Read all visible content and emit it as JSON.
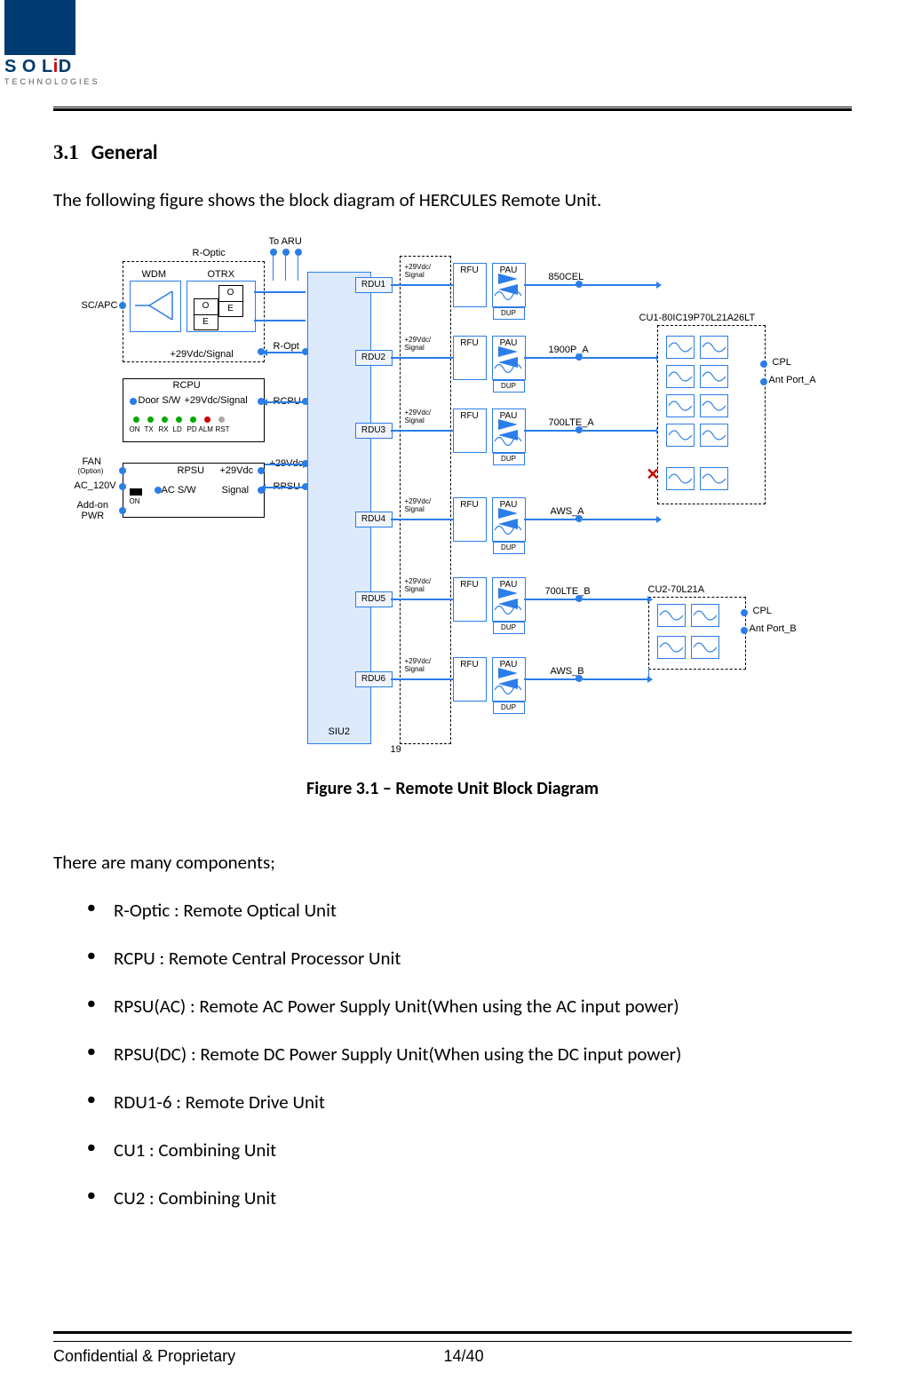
{
  "logo": {
    "brand_main": "S O L",
    "brand_i": "i",
    "brand_d": "D",
    "brand_sub": "TECHNOLOGIES"
  },
  "section": {
    "number": "3.1",
    "title": "General"
  },
  "intro": "The following figure shows the block diagram of HERCULES Remote Unit.",
  "figure_caption": "Figure 3.1 – Remote Unit Block Diagram",
  "components_intro": "There are many components;",
  "components": [
    "R-Optic : Remote Optical Unit",
    "RCPU : Remote Central Processor Unit",
    "RPSU(AC) :    Remote AC Power Supply Unit(When using the AC input power)",
    "RPSU(DC) :    Remote DC Power Supply Unit(When using the DC input power)",
    "RDU1-6 : Remote Drive Unit",
    "CU1 : Combining Unit",
    "CU2 : Combining Unit"
  ],
  "footer": {
    "left": "Confidential & Proprietary",
    "page": "14/40"
  },
  "diagram": {
    "labels": {
      "to_aru": "To ARU",
      "r_optic": "R-Optic",
      "wdm": "WDM",
      "otrx": "OTRX",
      "sc_apc": "SC/APC",
      "o": "O",
      "e": "E",
      "p29_sig": "+29Vdc/Signal",
      "r_opt": "R-Opt",
      "rcpu": "RCPU",
      "door_sw": "Door S/W",
      "p29_sig2": "+29Vdc/Signal",
      "on": "ON",
      "tx": "TX",
      "rx": "RX",
      "ld": "LD",
      "pd": "PD",
      "alm": "ALM",
      "rst": "RST",
      "fan": "FAN",
      "option": "(Option)",
      "ac120": "AC_120V",
      "addon": "Add-on",
      "pwr": "PWR",
      "rpsu": "RPSU",
      "p29": "+29Vdc",
      "acsw": "AC S/W",
      "signal": "Signal",
      "siu2": "SIU2",
      "rdu1": "RDU1",
      "rdu2": "RDU2",
      "rdu3": "RDU3",
      "rdu4": "RDU4",
      "rdu5": "RDU5",
      "rdu6": "RDU6",
      "p29vdc_sig_tiny": "+29Vdc/\nSignal",
      "rfu": "RFU",
      "pau": "PAU",
      "dup": "DUP",
      "band1": "850CEL",
      "band2": "1900P_A",
      "band3": "700LTE_A",
      "band4": "AWS_A",
      "band5": "700LTE_B",
      "band6": "AWS_B",
      "cu1": "CU1-80IC19P70L21A26LT",
      "cu2": "CU2-70L21A",
      "cpl": "CPL",
      "ant_a": "Ant Port_A",
      "ant_b": "Ant Port_B",
      "n19": "19"
    }
  }
}
